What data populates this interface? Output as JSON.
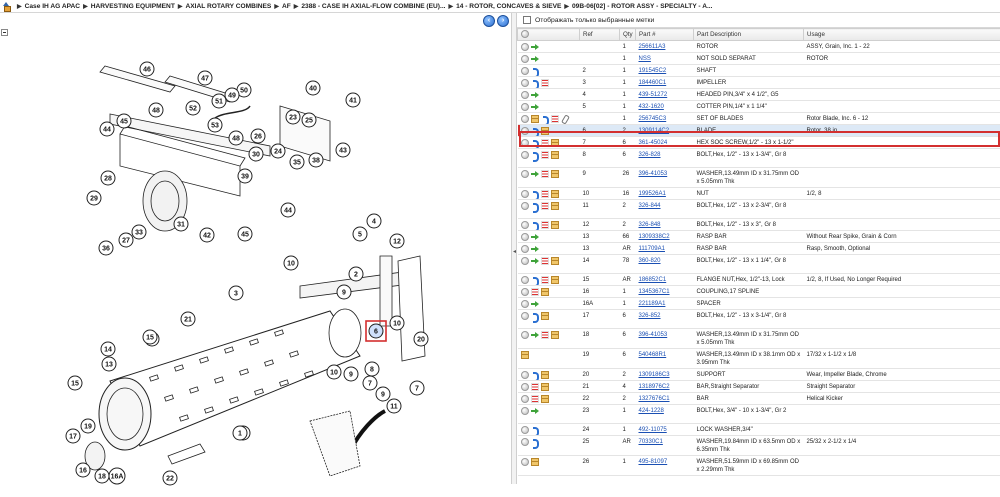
{
  "breadcrumb": [
    "Case IH AG APAC",
    "HARVESTING EQUIPMENT",
    "AXIAL ROTARY COMBINES",
    "AF",
    "2388 - CASE IH AXIAL-FLOW COMBINE (EU)...",
    "14 - ROTOR, CONCAVES & SIEVE",
    "09B-06[02] - ROTOR ASSY - SPECIALTY - A..."
  ],
  "filter": {
    "label": "Отображать только выбранные метки"
  },
  "columns": [
    "Ref",
    "Qty",
    "Part #",
    "Part Description",
    "Usage"
  ],
  "diagram": {
    "callouts": [
      "46",
      "47",
      "48",
      "45",
      "44",
      "40",
      "41",
      "50",
      "49",
      "51",
      "52",
      "53",
      "43",
      "25",
      "23",
      "26",
      "24",
      "48",
      "30",
      "35",
      "38",
      "28",
      "29",
      "36",
      "27",
      "33",
      "31",
      "42",
      "45",
      "39",
      "44",
      "4",
      "5",
      "12",
      "10",
      "9",
      "2",
      "3",
      "21",
      "14",
      "15",
      "13",
      "15",
      "6",
      "10",
      "20",
      "9",
      "8",
      "7",
      "10",
      "9",
      "11",
      "7",
      "1",
      "17",
      "19",
      "18",
      "16",
      "16A",
      "22",
      "15",
      "1"
    ],
    "highlight": "6"
  },
  "rows": [
    {
      "icons": [
        "dot",
        "green"
      ],
      "ref": "",
      "qty": "1",
      "part": "256611A3",
      "desc": "ROTOR",
      "usage": "ASSY, Grain, Inc. 1 - 22"
    },
    {
      "icons": [
        "dot",
        "green"
      ],
      "ref": "",
      "qty": "1",
      "part": "NSS",
      "desc": "NOT SOLD SEPARAT",
      "usage": "ROTOR"
    },
    {
      "icons": [
        "dot",
        "blue"
      ],
      "ref": "2",
      "qty": "1",
      "part": "191545C2",
      "desc": "SHAFT",
      "usage": ""
    },
    {
      "icons": [
        "dot",
        "blue",
        "list"
      ],
      "ref": "3",
      "qty": "1",
      "part": "184460C1",
      "desc": "IMPELLER",
      "usage": ""
    },
    {
      "icons": [
        "dot",
        "green"
      ],
      "ref": "4",
      "qty": "1",
      "part": "439-51272",
      "desc": "HEADED PIN,3/4\" x 4 1/2\", G5",
      "usage": ""
    },
    {
      "icons": [
        "dot",
        "green"
      ],
      "ref": "5",
      "qty": "1",
      "part": "432-1620",
      "desc": "COTTER PIN,1/4\" x 1 1/4\"",
      "usage": ""
    },
    {
      "icons": [
        "dot",
        "box",
        "blue",
        "list",
        "clip"
      ],
      "ref": "",
      "qty": "1",
      "part": "256745C3",
      "desc": "SET OF BLADES",
      "usage": "Rotor Blade, Inc. 6 - 12"
    },
    {
      "icons": [
        "dot",
        "blue",
        "box"
      ],
      "ref": "6",
      "qty": "2",
      "part": "1309114C2",
      "desc": "BLADE",
      "usage": "Rotor, 38 in",
      "selected": true
    },
    {
      "icons": [
        "dot",
        "blue",
        "list",
        "box"
      ],
      "ref": "7",
      "qty": "6",
      "part": "361-45024",
      "desc": "HEX SOC SCREW,1/2\" - 13 x 1-1/2\"",
      "usage": ""
    },
    {
      "icons": [
        "dot",
        "blue",
        "list",
        "box"
      ],
      "ref": "8",
      "qty": "6",
      "part": "326-828",
      "desc": "BOLT,Hex, 1/2\" - 13 x 1-3/4\", Gr 8",
      "usage": ""
    },
    {
      "icons": [
        "dot",
        "green",
        "list",
        "box"
      ],
      "ref": "9",
      "qty": "26",
      "part": "396-41053",
      "desc": "WASHER,13.49mm ID x 31.75mm OD x 5.05mm Thk",
      "usage": ""
    },
    {
      "icons": [
        "dot",
        "blue",
        "list",
        "box"
      ],
      "ref": "10",
      "qty": "16",
      "part": "199526A1",
      "desc": "NUT",
      "usage": "1/2, 8"
    },
    {
      "icons": [
        "dot",
        "blue",
        "list",
        "box"
      ],
      "ref": "11",
      "qty": "2",
      "part": "326-844",
      "desc": "BOLT,Hex, 1/2\" - 13 x 2-3/4\", Gr 8",
      "usage": ""
    },
    {
      "icons": [
        "dot",
        "blue",
        "list",
        "box"
      ],
      "ref": "12",
      "qty": "2",
      "part": "326-848",
      "desc": "BOLT,Hex, 1/2\" - 13 x 3\", Gr 8",
      "usage": ""
    },
    {
      "icons": [
        "dot",
        "green"
      ],
      "ref": "13",
      "qty": "66",
      "part": "1309338C2",
      "desc": "RASP BAR",
      "usage": "Without Rear Spike, Grain & Corn"
    },
    {
      "icons": [
        "dot",
        "green"
      ],
      "ref": "13",
      "qty": "AR",
      "part": "111709A1",
      "desc": "RASP BAR",
      "usage": "Rasp, Smooth, Optional"
    },
    {
      "icons": [
        "dot",
        "green",
        "list",
        "box"
      ],
      "ref": "14",
      "qty": "78",
      "part": "360-820",
      "desc": "BOLT,Hex, 1/2\" - 13 x 1 1/4\", Gr 8",
      "usage": ""
    },
    {
      "icons": [
        "dot",
        "blue",
        "list",
        "box"
      ],
      "ref": "15",
      "qty": "AR",
      "part": "186852C1",
      "desc": "FLANGE NUT,Hex, 1/2\"-13, Lock",
      "usage": "1/2, 8, If Used, No Longer Required"
    },
    {
      "icons": [
        "dot",
        "list",
        "box"
      ],
      "ref": "16",
      "qty": "1",
      "part": "1345367C1",
      "desc": "COUPLING,17 SPLINE",
      "usage": ""
    },
    {
      "icons": [
        "dot",
        "green"
      ],
      "ref": "16A",
      "qty": "1",
      "part": "221189A1",
      "desc": "SPACER",
      "usage": ""
    },
    {
      "icons": [
        "dot",
        "blue",
        "box"
      ],
      "ref": "17",
      "qty": "6",
      "part": "326-852",
      "desc": "BOLT,Hex, 1/2\" - 13 x 3-1/4\", Gr 8",
      "usage": ""
    },
    {
      "icons": [
        "dot",
        "green",
        "list",
        "box"
      ],
      "ref": "18",
      "qty": "6",
      "part": "396-41053",
      "desc": "WASHER,13.49mm ID x 31.75mm OD x 5.05mm Thk",
      "usage": ""
    },
    {
      "icons": [
        "box"
      ],
      "ref": "19",
      "qty": "6",
      "part": "540468R1",
      "desc": "WASHER,13.49mm ID x 38.1mm OD x 3.95mm Thk",
      "usage": "17/32 x 1-1/2 x 1/8"
    },
    {
      "icons": [
        "dot",
        "blue",
        "box"
      ],
      "ref": "20",
      "qty": "2",
      "part": "1309186C3",
      "desc": "SUPPORT",
      "usage": "Wear, Impeller Blade, Chrome"
    },
    {
      "icons": [
        "dot",
        "list",
        "box"
      ],
      "ref": "21",
      "qty": "4",
      "part": "1318976C2",
      "desc": "BAR,Straight Separator",
      "usage": "Straight Separator"
    },
    {
      "icons": [
        "dot",
        "list",
        "box"
      ],
      "ref": "22",
      "qty": "2",
      "part": "1327676C1",
      "desc": "BAR",
      "usage": "Helical Kicker"
    },
    {
      "icons": [
        "dot",
        "green"
      ],
      "ref": "23",
      "qty": "1",
      "part": "424-1228",
      "desc": "BOLT,Hex, 3/4\" - 10 x 1-3/4\", Gr 2",
      "usage": ""
    },
    {
      "icons": [
        "dot",
        "blue"
      ],
      "ref": "24",
      "qty": "1",
      "part": "492-11075",
      "desc": "LOCK WASHER,3/4\"",
      "usage": ""
    },
    {
      "icons": [
        "dot",
        "blue"
      ],
      "ref": "25",
      "qty": "AR",
      "part": "70330C1",
      "desc": "WASHER,19.84mm ID x 63.5mm OD x 6.35mm Thk",
      "usage": "25/32 x 2-1/2 x 1/4"
    },
    {
      "icons": [
        "dot",
        "box"
      ],
      "ref": "26",
      "qty": "1",
      "part": "495-81097",
      "desc": "WASHER,51.59mm ID x 69.85mm OD x 2.29mm Thk",
      "usage": ""
    }
  ]
}
